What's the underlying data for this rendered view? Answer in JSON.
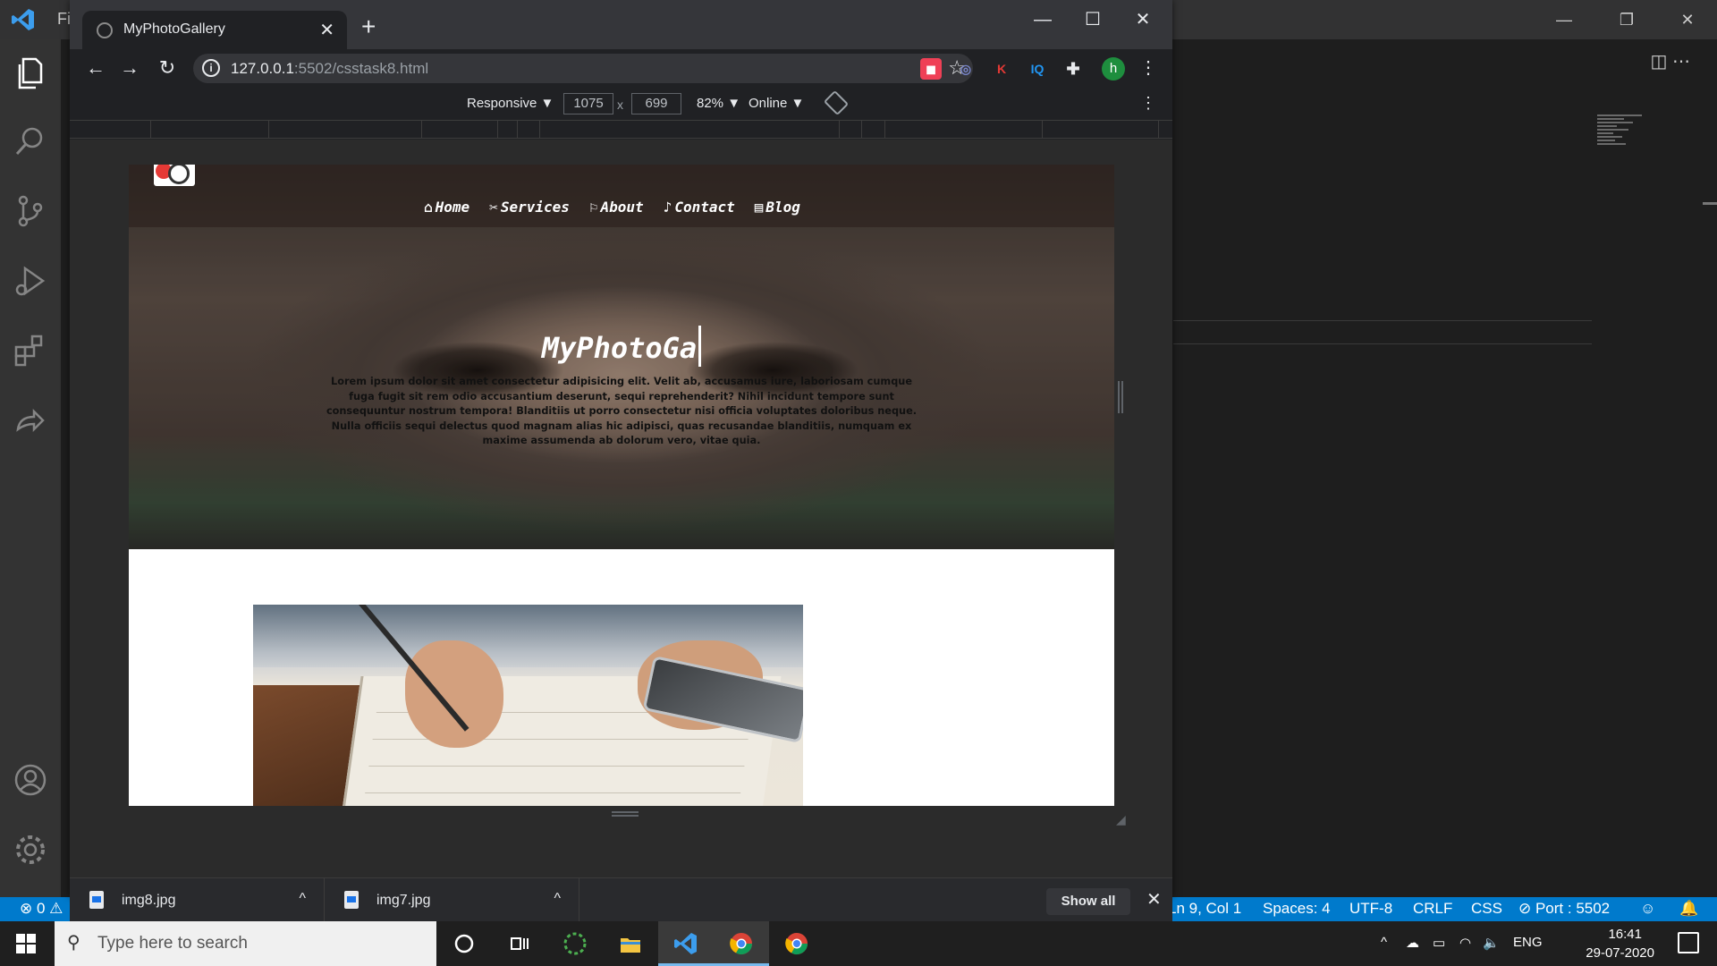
{
  "vscode": {
    "menu_first_letter": "Fi",
    "win_minimize": "—",
    "win_restore": "❐",
    "win_close": "✕",
    "editor_actions": "◫   ⋯",
    "statusbar": {
      "errors": "⊗ 0 ⚠",
      "position": "Ln 9, Col 1",
      "spaces": "Spaces: 4",
      "encoding": "UTF-8",
      "eol": "CRLF",
      "language": "CSS",
      "port": "⊘ Port : 5502",
      "feedback": "☺",
      "bell": "🔔"
    }
  },
  "browser": {
    "tab_title": "MyPhotoGallery",
    "tab_close": "✕",
    "new_tab": "+",
    "win_minimize": "—",
    "win_maximize": "☐",
    "win_close": "✕",
    "back": "←",
    "forward": "→",
    "reload": "↻",
    "url_host": "127.0.0.1",
    "url_path": ":5502/csstask8.html",
    "star": "☆",
    "avatar_letter": "h",
    "menu": "⋮",
    "extensions": [
      {
        "name": "pocket",
        "label": "◼",
        "color": "#ef4056"
      },
      {
        "name": "eye",
        "label": "◎",
        "color": "#7986cb"
      },
      {
        "name": "k",
        "label": "K",
        "color": "#e53935"
      },
      {
        "name": "iq",
        "label": "IQ",
        "color": "#2196f3"
      },
      {
        "name": "puzzle",
        "label": "✚",
        "color": "#e8eaed"
      }
    ]
  },
  "devtools": {
    "mode": "Responsive ▼",
    "width": "1075",
    "times": "x",
    "height": "699",
    "zoom": "82% ▼",
    "network": "Online ▼",
    "more": "⋮"
  },
  "site": {
    "nav": [
      {
        "icon": "⌂",
        "label": "Home"
      },
      {
        "icon": "✂",
        "label": "Services"
      },
      {
        "icon": "⚐",
        "label": "About"
      },
      {
        "icon": "♪",
        "label": "Contact"
      },
      {
        "icon": "▤",
        "label": "Blog"
      }
    ],
    "title": "MyPhotoGa",
    "paragraph": "Lorem ipsum dolor sit amet consectetur adipisicing elit. Velit ab, accusamus iure, laboriosam cumque fuga fugit sit rem odio accusantium deserunt, sequi reprehenderit? Nihil incidunt tempore sunt consequuntur nostrum tempora! Blanditiis ut porro consectetur nisi officia voluptates doloribus neque. Nulla officiis sequi delectus quod magnam alias hic adipisci, quas recusandae blanditiis, numquam ex maxime assumenda ab dolorum vero, vitae quia."
  },
  "downloads": {
    "items": [
      {
        "name": "img8.jpg",
        "chevron": "^"
      },
      {
        "name": "img7.jpg",
        "chevron": "^"
      }
    ],
    "show_all": "Show all",
    "close": "✕"
  },
  "taskbar": {
    "search_placeholder": "Type here to search",
    "search_icon": "⚲",
    "tray": {
      "chevron": "^",
      "cloud": "☁",
      "battery": "▭",
      "wifi": "◠",
      "volume": "🔈",
      "lang": "ENG",
      "time": "16:41",
      "date": "29-07-2020"
    }
  }
}
